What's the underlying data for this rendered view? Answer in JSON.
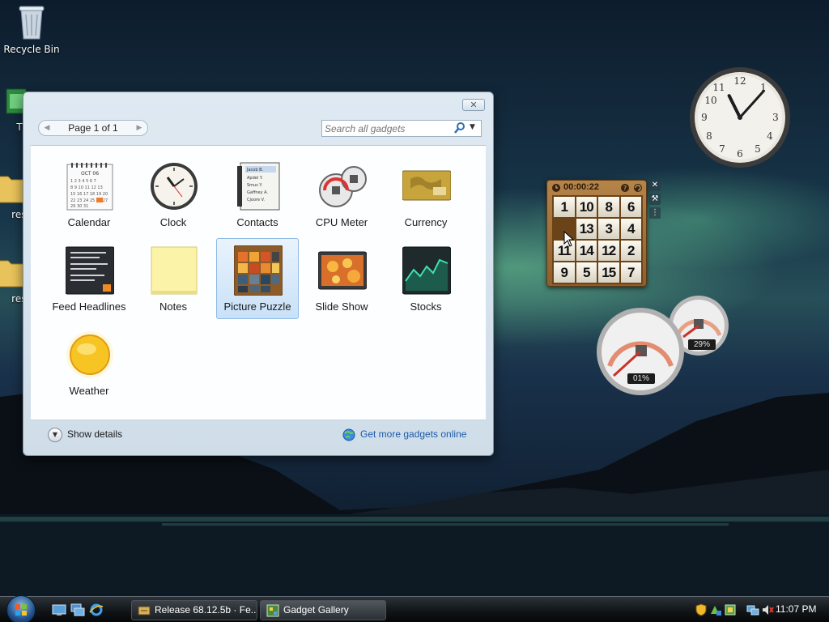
{
  "desktop": {
    "icons": [
      {
        "label": "Recycle Bin"
      },
      {
        "label": "TLa"
      },
      {
        "label": "reso"
      },
      {
        "label": "reso"
      }
    ]
  },
  "gallery": {
    "close_glyph": "✕",
    "pager": {
      "label": "Page 1 of 1",
      "prev_glyph": "◀",
      "next_glyph": "▶"
    },
    "search": {
      "placeholder": "Search all gadgets",
      "icon": "magnifier-icon",
      "dropdown_glyph": "▼"
    },
    "gadgets": [
      {
        "name": "Calendar"
      },
      {
        "name": "Clock"
      },
      {
        "name": "Contacts"
      },
      {
        "name": "CPU Meter"
      },
      {
        "name": "Currency"
      },
      {
        "name": "Feed Headlines"
      },
      {
        "name": "Notes"
      },
      {
        "name": "Picture Puzzle",
        "selected": true
      },
      {
        "name": "Slide Show"
      },
      {
        "name": "Stocks"
      },
      {
        "name": "Weather"
      }
    ],
    "calendar_art": {
      "month": "OCT 06"
    },
    "contacts_art": {
      "entries": [
        "Jacob B.",
        "Apdel Y.",
        "Smus Y.",
        "Gaffney A.",
        "Cjoore V."
      ]
    },
    "show_details": "Show details",
    "show_details_glyph": "▼",
    "more_gadgets": "Get more gadgets online"
  },
  "puzzle_gadget": {
    "timer": "00:00:22",
    "tiles": [
      "1",
      "10",
      "8",
      "6",
      "",
      "13",
      "3",
      "4",
      "11",
      "14",
      "12",
      "2",
      "9",
      "5",
      "15",
      "7"
    ],
    "tools": [
      "✕",
      "⚒",
      "⋮"
    ]
  },
  "cpu_gadget": {
    "cpu": "01%",
    "memory": "29%"
  },
  "clock_gadget": {
    "hour": 11,
    "minute": 7
  },
  "taskbar": {
    "buttons": [
      {
        "label": "Release 68.12.5b · Fe..."
      },
      {
        "label": "Gadget Gallery",
        "active": true
      }
    ],
    "clock": "11:07 PM"
  },
  "colors": {
    "accent": "#1d5aaa",
    "selection": "#c9e1f8"
  }
}
